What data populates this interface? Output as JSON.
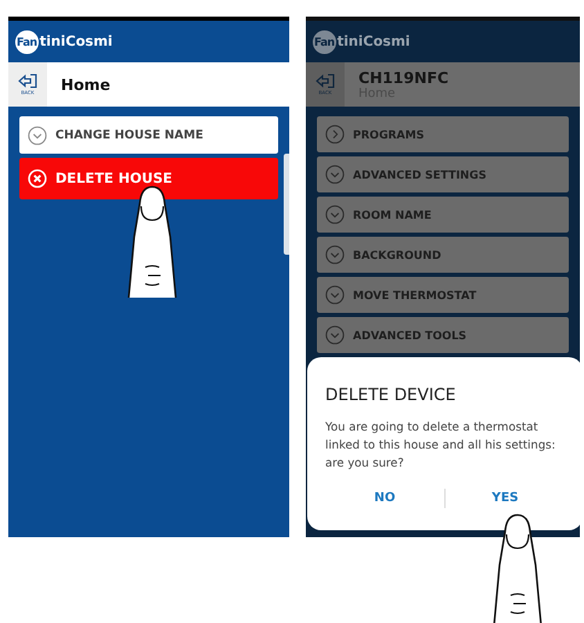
{
  "screens": [
    {
      "dimmed": false,
      "logo": {
        "badge": "Fan",
        "rest": "tiniCosmi"
      },
      "back": "BACK",
      "title": "Home",
      "items": [
        {
          "label": "CHANGE HOUSE NAME",
          "kind": "expand"
        },
        {
          "label": "DELETE HOUSE",
          "kind": "delete"
        }
      ]
    },
    {
      "dimmed": true,
      "logo": {
        "badge": "Fan",
        "rest": "tiniCosmi"
      },
      "back": "BACK",
      "title": "CH119NFC",
      "subtitle": "Home",
      "items": [
        {
          "label": "PROGRAMS",
          "kind": "open"
        },
        {
          "label": "ADVANCED SETTINGS",
          "kind": "expand"
        },
        {
          "label": "ROOM NAME",
          "kind": "expand"
        },
        {
          "label": "BACKGROUND",
          "kind": "expand"
        },
        {
          "label": "MOVE THERMOSTAT",
          "kind": "expand"
        },
        {
          "label": "ADVANCED TOOLS",
          "kind": "expand"
        }
      ],
      "dialog": {
        "title": "DELETE DEVICE",
        "message": "You are going to delete a thermostat linked to this house and all his settings: are you sure?",
        "buttons": [
          "NO",
          "YES"
        ]
      }
    }
  ]
}
